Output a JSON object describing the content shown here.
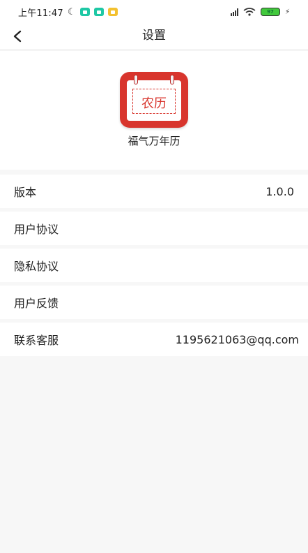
{
  "status_bar": {
    "time": "上午11:47",
    "battery": "97"
  },
  "nav": {
    "title": "设置"
  },
  "app": {
    "icon_text": "农历",
    "name": "福气万年历"
  },
  "settings": [
    {
      "label": "版本",
      "value": "1.0.0"
    },
    {
      "label": "用户协议",
      "value": ""
    },
    {
      "label": "隐私协议",
      "value": ""
    },
    {
      "label": "用户反馈",
      "value": ""
    },
    {
      "label": "联系客服",
      "value": "1195621063@qq.com"
    }
  ],
  "colors": {
    "brand_red": "#d8352d",
    "background": "#f7f7f7",
    "battery_green": "#41c93c"
  }
}
